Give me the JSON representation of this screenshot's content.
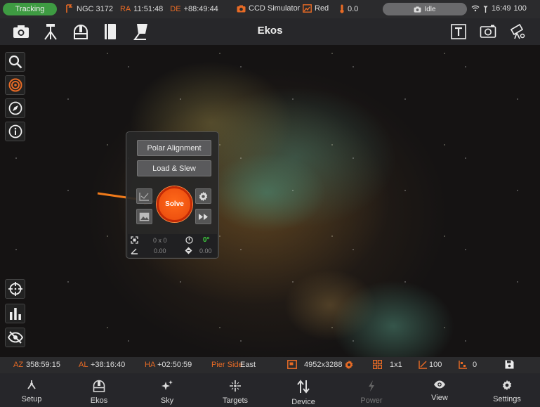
{
  "status": {
    "tracking": "Tracking",
    "target": "NGC 3172",
    "ra_label": "RA",
    "ra_value": "11:51:48",
    "de_label": "DE",
    "de_value": "+88:49:44",
    "camera": "CCD Simulator",
    "filter": "Red",
    "temperature": "0.0",
    "capture_state": "Idle",
    "time": "16:49",
    "battery": "100"
  },
  "toolbar": {
    "title": "Ekos"
  },
  "solver": {
    "polar_alignment_label": "Polar Alignment",
    "load_slew_label": "Load & Slew",
    "solve_label": "Solve",
    "field": "0 x 0",
    "rotation_value": "0°",
    "angle_value": "0.00",
    "pixscale_value": "0.00"
  },
  "info": {
    "az_label": "AZ",
    "az_value": "358:59:15",
    "al_label": "AL",
    "al_value": "+38:16:40",
    "ha_label": "HA",
    "ha_value": "+02:50:59",
    "pier_label": "Pier Side",
    "pier_value": "East",
    "resolution": "4952x3288",
    "binning": "1x1",
    "gain": "100",
    "offset": "0"
  },
  "nav": {
    "items": [
      {
        "label": "Setup"
      },
      {
        "label": "Ekos"
      },
      {
        "label": "Sky"
      },
      {
        "label": "Targets"
      },
      {
        "label": "Device"
      },
      {
        "label": "Power"
      },
      {
        "label": "View"
      },
      {
        "label": "Settings"
      }
    ]
  },
  "colors": {
    "accent": "#e96b25",
    "tracking": "#3e9b42",
    "solve": "#ff5a14",
    "rotation_ok": "#3ecf3e"
  }
}
